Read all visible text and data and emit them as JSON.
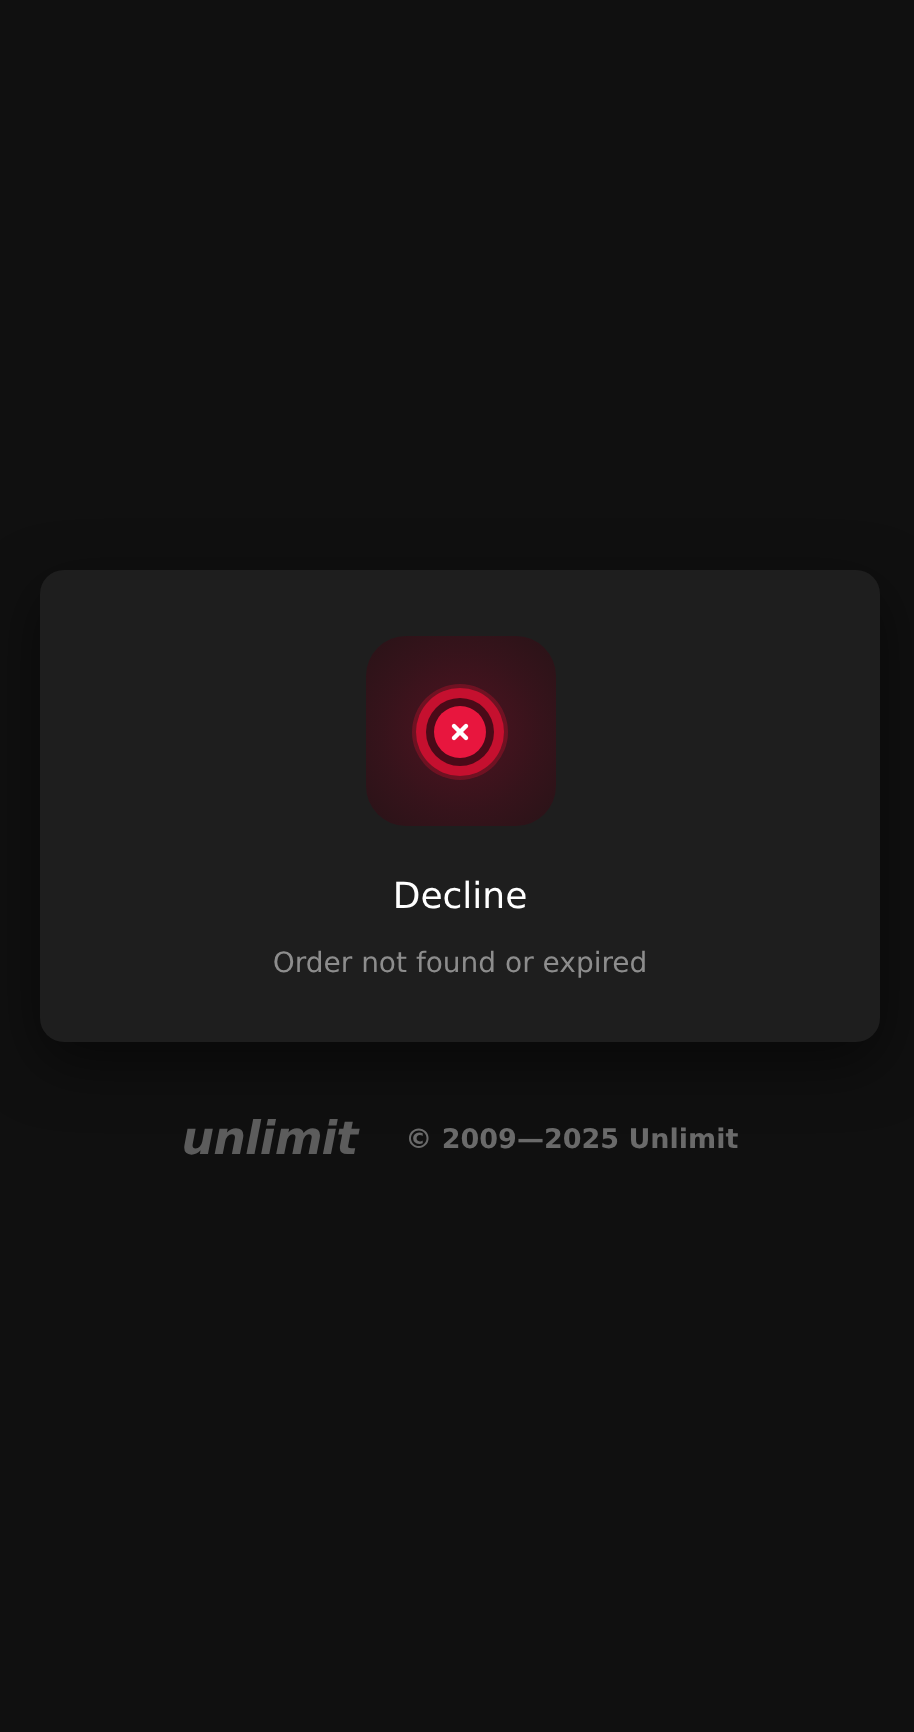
{
  "status": {
    "kind": "decline",
    "title": "Decline",
    "message": "Order not found or expired"
  },
  "footer": {
    "logo": "unlimit",
    "copyright": "© 2009—2025 Unlimit"
  }
}
